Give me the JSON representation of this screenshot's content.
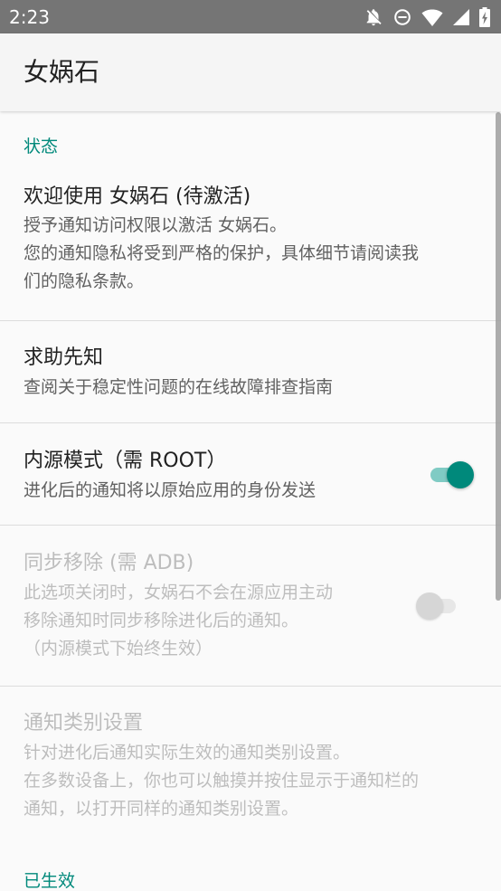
{
  "status_bar": {
    "time": "2:23",
    "icons": [
      "notifications-off-icon",
      "do-not-disturb-icon",
      "wifi-icon",
      "cell-signal-icon",
      "battery-charging-icon"
    ],
    "background": "#757575"
  },
  "app_bar": {
    "title": "女娲石"
  },
  "sections": {
    "status": {
      "header": "状态"
    },
    "active": {
      "header": "已生效"
    }
  },
  "preferences": {
    "welcome": {
      "title": "欢迎使用 女娲石 (待激活)",
      "summary_lines": [
        "授予通知访问权限以激活 女娲石。",
        "您的通知隐私将受到严格的保护，具体细节请阅读我",
        "们的隐私条款。"
      ]
    },
    "help": {
      "title": "求助先知",
      "summary_lines": [
        "查阅关于稳定性问题的在线故障排查指南"
      ]
    },
    "inner_source": {
      "title": "内源模式（需 ROOT）",
      "summary_lines": [
        "进化后的通知将以原始应用的身份发送"
      ],
      "enabled": true
    },
    "sync_remove": {
      "title": "同步移除 (需 ADB)",
      "summary_lines": [
        "此选项关闭时，女娲石不会在源应用主动",
        "移除通知时同步移除进化后的通知。",
        "（内源模式下始终生效）"
      ],
      "enabled": false,
      "disabled": true
    },
    "channel_settings": {
      "title": "通知类别设置",
      "summary_lines": [
        "针对进化后通知实际生效的通知类别设置。",
        "在多数设备上，你也可以触摸并按住显示于通知栏的",
        "通知，以打开同样的通知类别设置。"
      ],
      "disabled": true
    }
  },
  "colors": {
    "accent": "#00897b",
    "accent_track": "#80cbc4",
    "text_primary": "#212121",
    "text_secondary": "#616161",
    "text_disabled": "#bdbdbd"
  }
}
